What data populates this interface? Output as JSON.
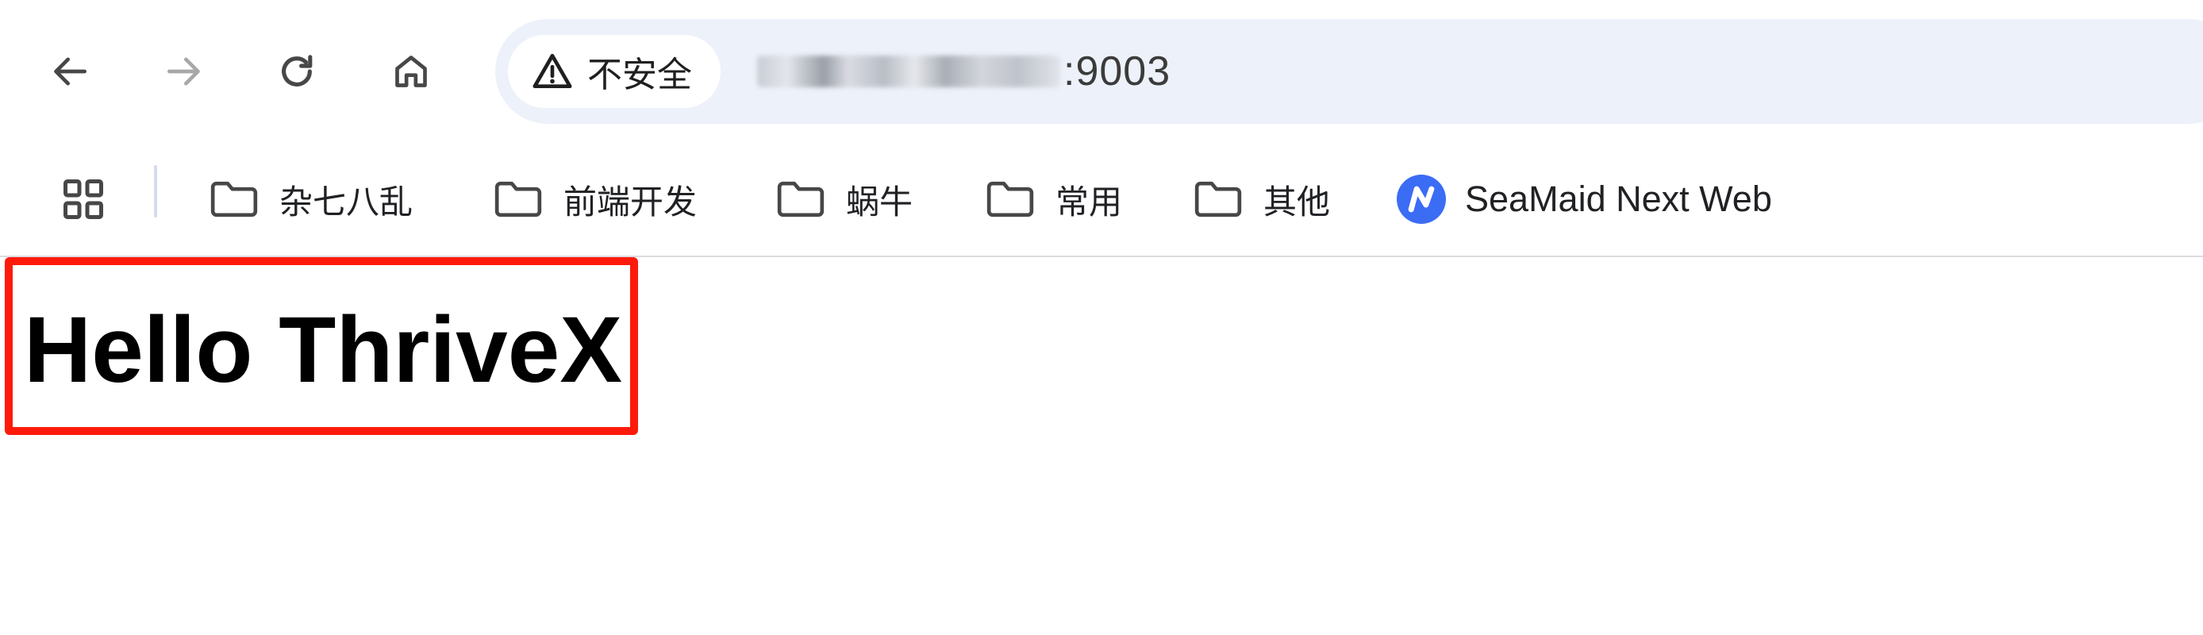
{
  "browser": {
    "nav": {
      "back_icon": "arrow-left-icon",
      "forward_icon": "arrow-right-icon",
      "reload_icon": "reload-icon",
      "home_icon": "home-icon"
    },
    "omnibox": {
      "security_icon": "warning-triangle-icon",
      "security_label": "不安全",
      "url_suffix": ":9003"
    },
    "bookmarks": [
      {
        "label": "杂七八乱",
        "icon": "folder-icon"
      },
      {
        "label": "前端开发",
        "icon": "folder-icon"
      },
      {
        "label": "蜗牛",
        "icon": "folder-icon"
      },
      {
        "label": "常用",
        "icon": "folder-icon"
      },
      {
        "label": "其他",
        "icon": "folder-icon"
      },
      {
        "label": "SeaMaid Next Web",
        "icon": "seamaid-logo-icon"
      }
    ]
  },
  "page": {
    "heading": "Hello ThriveX"
  },
  "colors": {
    "omnibox_bg": "#edf1fa",
    "highlight_border": "#fe1a0b",
    "seamaid_brand": "#3b6cf4"
  }
}
